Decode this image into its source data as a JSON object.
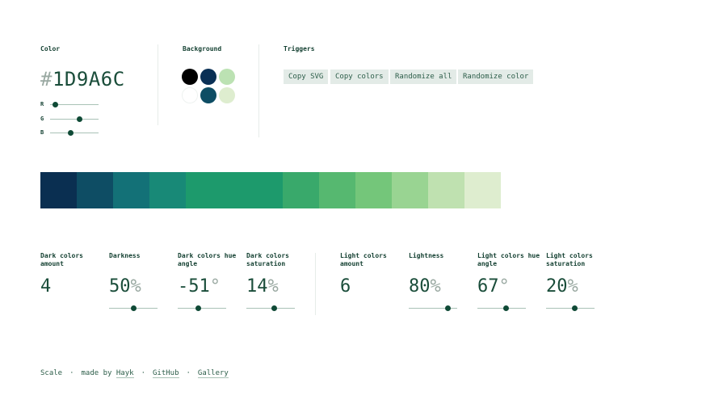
{
  "color": {
    "label": "Color",
    "hash": "#",
    "hex": "1D9A6C",
    "channels": [
      {
        "name": "R",
        "value": 29
      },
      {
        "name": "G",
        "value": 154
      },
      {
        "name": "B",
        "value": 108
      }
    ]
  },
  "background": {
    "label": "Background",
    "swatches": [
      "#000000",
      "#0a3055",
      "#bce2b3",
      "#ffffff",
      "#0e4d64",
      "#deedcf"
    ]
  },
  "triggers": {
    "label": "Triggers",
    "buttons": [
      "Copy SVG",
      "Copy colors",
      "Randomize all",
      "Randomize color"
    ]
  },
  "palette": [
    "#0a2f51",
    "#0e4d64",
    "#137177",
    "#188977",
    "#1d9a6c",
    "#39a96b",
    "#56b870",
    "#74c67a",
    "#99d492",
    "#bfe1b0",
    "#deedcf"
  ],
  "stats": [
    {
      "label": "Dark colors amount",
      "value": "4",
      "unit": ""
    },
    {
      "label": "Darkness",
      "value": "50",
      "unit": "%",
      "level": 0.5
    },
    {
      "label": "Dark colors hue angle",
      "value": "-51",
      "unit": "°",
      "level": 0.43
    },
    {
      "label": "Dark colors saturation",
      "value": "14",
      "unit": "%",
      "level": 0.57
    },
    {
      "label": "Light colors amount",
      "value": "6",
      "unit": ""
    },
    {
      "label": "Lightness",
      "value": "80",
      "unit": "%",
      "level": 0.8
    },
    {
      "label": "Light colors hue angle",
      "value": "67",
      "unit": "°",
      "level": 0.59
    },
    {
      "label": "Light colors saturation",
      "value": "20",
      "unit": "%",
      "level": 0.59
    }
  ],
  "footer": {
    "app": "Scale",
    "made_by": "made by",
    "author": "Hayk",
    "github": "GitHub",
    "gallery": "Gallery",
    "sep": "·"
  }
}
